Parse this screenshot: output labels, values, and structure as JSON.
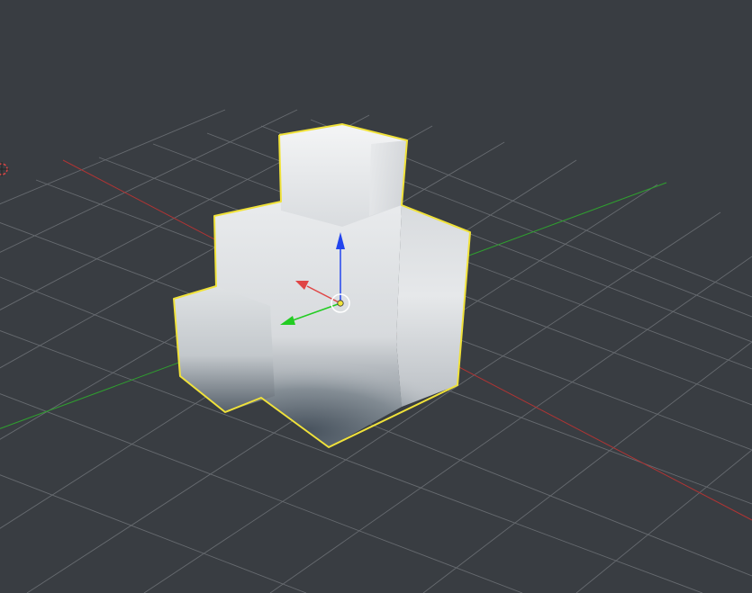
{
  "viewport": {
    "mode": "3d-perspective",
    "background_color": "#393d42",
    "grid_color": "#6f7378",
    "x_axis_color": "#b03434",
    "y_axis_color": "#2fa02f",
    "selection_outline_color": "#f0e23a"
  },
  "selected_object": {
    "type": "mesh",
    "shape": "stacked blocks",
    "shading": "smooth",
    "selected": true
  },
  "transform_gizmo": {
    "type": "translate",
    "axes": [
      {
        "axis": "x",
        "color": "#e04545"
      },
      {
        "axis": "y",
        "color": "#22cc22"
      },
      {
        "axis": "z",
        "color": "#2244ee"
      }
    ],
    "pivot_icon": "origin-circle-icon"
  },
  "scene_elements": {
    "cursor_3d_icon": "3d-cursor-icon"
  }
}
